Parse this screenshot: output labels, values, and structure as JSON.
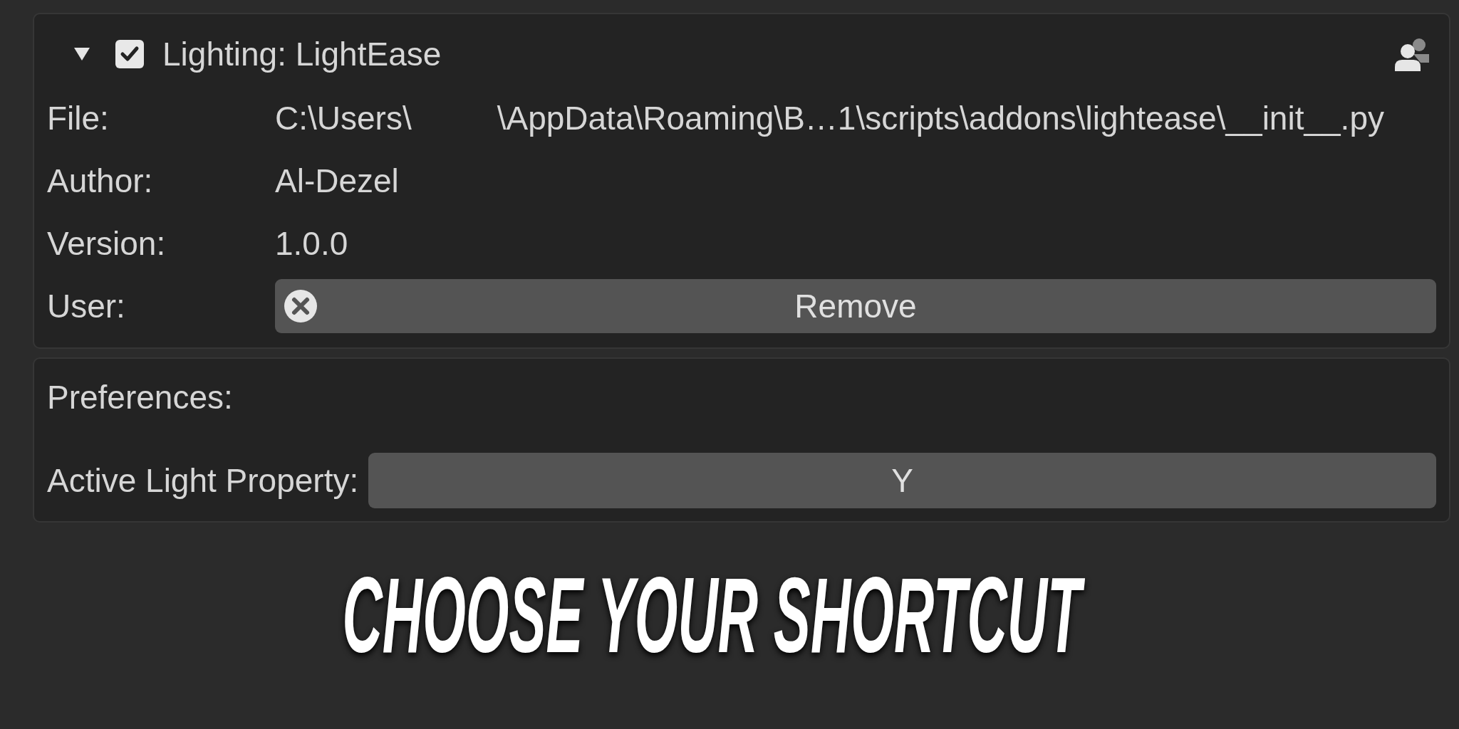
{
  "addon": {
    "expanded": true,
    "enabled": true,
    "title": "Lighting: LightEase",
    "fields": [
      {
        "label": "File:",
        "kind": "path",
        "parts": [
          "C:\\Users\\",
          "\\AppData\\Roaming\\B…1\\scripts\\addons\\lightease\\__init__.py"
        ]
      },
      {
        "label": "Author:",
        "kind": "text",
        "value": "Al-Dezel"
      },
      {
        "label": "Version:",
        "kind": "text",
        "value": "1.0.0"
      },
      {
        "label": "User:",
        "kind": "button",
        "value": "Remove"
      }
    ]
  },
  "preferences": {
    "title": "Preferences:",
    "fields": [
      {
        "label": "Active Light Property:",
        "kind": "key",
        "value": "Y"
      }
    ]
  },
  "caption": "CHOOSE YOUR SHORTCUT"
}
